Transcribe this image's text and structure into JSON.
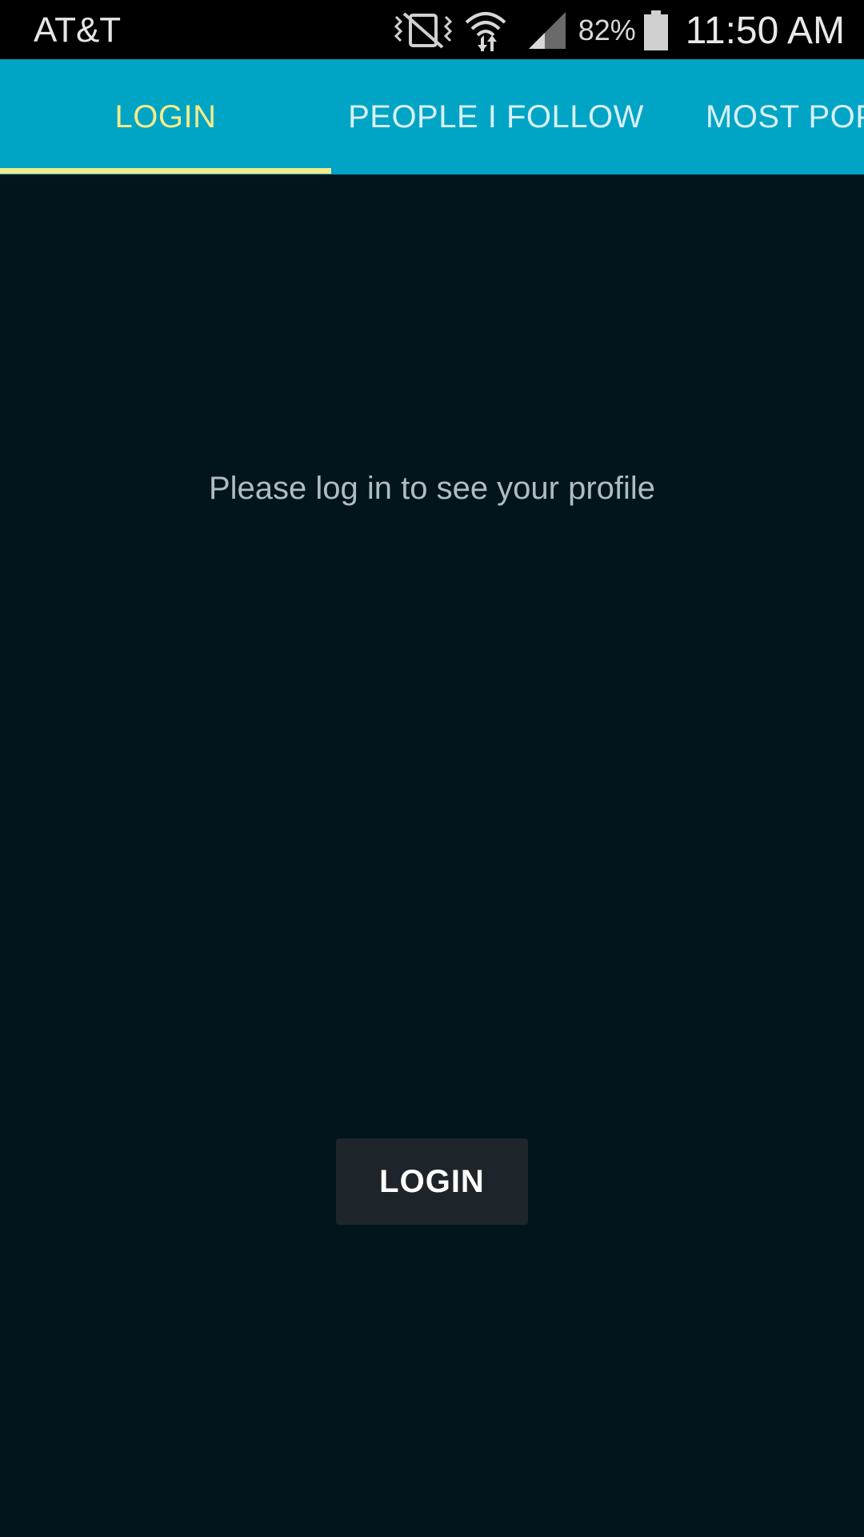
{
  "status_bar": {
    "carrier": "AT&T",
    "battery_percent": "82%",
    "time": "11:50 AM",
    "icons": [
      "vibrate-mute-icon",
      "wifi-icon",
      "signal-icon",
      "battery-icon"
    ]
  },
  "tabs": [
    {
      "label": "LOGIN",
      "selected": true
    },
    {
      "label": "PEOPLE I FOLLOW",
      "selected": false
    },
    {
      "label": "MOST POP",
      "selected": false
    }
  ],
  "content": {
    "message": "Please log in to see your profile",
    "login_button": "LOGIN"
  },
  "colors": {
    "tab_bar": "#00a4c4",
    "tab_active": "#f4ec8a",
    "background": "#02141c",
    "button": "#1d242a"
  }
}
